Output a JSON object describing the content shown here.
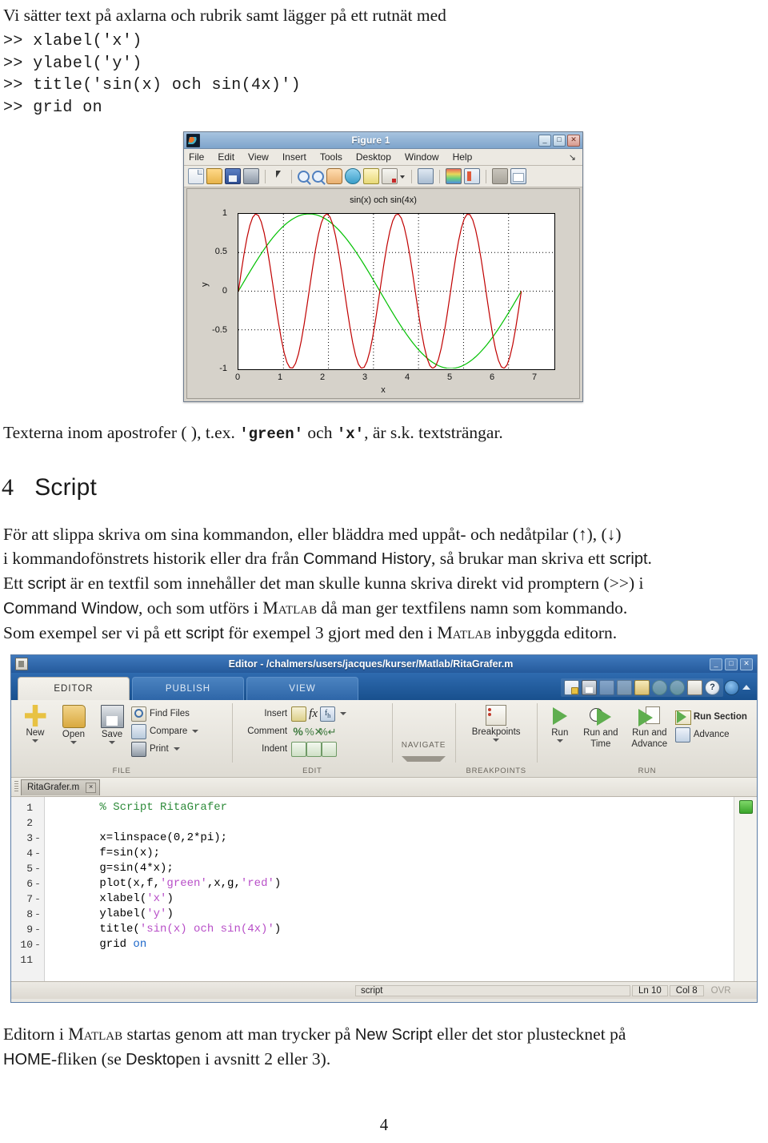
{
  "document": {
    "intro_sentence": "Vi sätter text på axlarna och rubrik samt lägger på ett rutnät med",
    "commands": [
      ">> xlabel('x')",
      ">> ylabel('y')",
      ">> title('sin(x) och sin(4x)')",
      ">> grid on"
    ],
    "texterna_line": {
      "part1": "Texterna inom apostrofer (  ), t.ex. ",
      "green": "'green'",
      "mid": " och ",
      "x": "'x'",
      "part2": ", är s.k. textsträngar."
    },
    "section": {
      "number": "4",
      "title": "Script"
    },
    "paragraph1": {
      "l1a": "För att slippa skriva om sina kommandon, eller bläddra med uppåt- och nedåtpilar (↑), (↓)",
      "l2a": "i kommandofönstrets historik eller dra från ",
      "l2b": "Command History",
      "l2c": ", så brukar man skriva ett ",
      "l2d": "script",
      "l2e": ".",
      "l3a": "Ett ",
      "l3b": "script",
      "l3c": " är en textfil som innehåller det man skulle kunna skriva direkt vid promptern (>>) i",
      "l4a": "Command Window",
      "l4b": ", och som utförs i ",
      "l4c": "Matlab",
      "l4d": " då man ger textfilens namn som kommando."
    },
    "paragraph2": {
      "a": "Som exempel ser vi på ett ",
      "b": "script",
      "c": " för exempel 3 gjort med den i ",
      "d": "Matlab",
      "e": " inbyggda editorn."
    },
    "paragraph3": {
      "a": "Editorn i ",
      "b": "Matlab",
      "c": " startas genom att man trycker på ",
      "d": "New Script",
      "e": " eller det stor plustecknet på",
      "f": "HOME",
      "g": "-fliken (se ",
      "h": "Desktop",
      "i": "en i avsnitt 2 eller 3)."
    },
    "page_number": "4"
  },
  "figure_window": {
    "title": "Figure 1",
    "window_buttons": {
      "minimize": "_",
      "maximize": "□",
      "close": "✕"
    },
    "menu": [
      "File",
      "Edit",
      "View",
      "Insert",
      "Tools",
      "Desktop",
      "Window",
      "Help"
    ],
    "dock_icon": "↘",
    "toolbar_icons": [
      "new-figure-icon",
      "open-file-icon",
      "save-figure-icon",
      "print-figure-icon",
      "pointer-icon",
      "zoom-in-icon",
      "zoom-out-icon",
      "pan-icon",
      "rotate-3d-icon",
      "data-cursor-icon",
      "brush-icon",
      "brush-dropdown-icon",
      "link-plot-icon",
      "colorbar-icon",
      "legend-icon",
      "plot-tools-off-icon",
      "plot-tools-on-icon"
    ]
  },
  "chart_data": {
    "type": "line",
    "title": "sin(x) och sin(4x)",
    "xlabel": "x",
    "ylabel": "y",
    "xlim": [
      0,
      7
    ],
    "ylim": [
      -1,
      1
    ],
    "xticks": [
      0,
      1,
      2,
      3,
      4,
      5,
      6,
      7
    ],
    "yticks": [
      -1,
      -0.5,
      0,
      0.5,
      1
    ],
    "grid": true,
    "grid_style": "dotted",
    "data_range_x": [
      0,
      6.2832
    ],
    "series": [
      {
        "name": "sin(x)",
        "color": "#00c000",
        "expression": "sin(x)",
        "points": 100
      },
      {
        "name": "sin(4x)",
        "color": "#c00000",
        "expression": "sin(4*x)",
        "points": 100
      }
    ]
  },
  "editor_window": {
    "title": "Editor - /chalmers/users/jacques/kurser/Matlab/RitaGrafer.m",
    "window_buttons": {
      "minimize": "_",
      "maximize": "□",
      "close": "✕"
    },
    "ribbon_tabs": [
      "EDITOR",
      "PUBLISH",
      "VIEW"
    ],
    "active_tab": "EDITOR",
    "quick_access_icons": [
      "new-script-icon",
      "save-icon",
      "cut-icon",
      "copy-icon",
      "paste-icon",
      "undo-icon",
      "redo-icon",
      "layout-icon",
      "help-icon",
      "quick-access-dropdown-icon",
      "minimize-ribbon-icon"
    ],
    "groups": [
      {
        "label": "FILE",
        "big_buttons": [
          {
            "label": "New",
            "icon": "new-file-icon",
            "has_arrow": true
          },
          {
            "label": "Open",
            "icon": "open-file-icon",
            "has_arrow": true
          },
          {
            "label": "Save",
            "icon": "save-file-icon",
            "has_arrow": true
          }
        ],
        "small_buttons": [
          {
            "label": "Find Files",
            "icon": "find-files-icon",
            "has_arrow": false
          },
          {
            "label": "Compare",
            "icon": "compare-icon",
            "has_arrow": true
          },
          {
            "label": "Print",
            "icon": "print-icon",
            "has_arrow": true
          }
        ]
      },
      {
        "label": "EDIT",
        "rows": [
          {
            "label": "Insert",
            "icons": [
              "insert-snippet-icon",
              "insert-function-icon",
              "insert-fh-icon"
            ],
            "has_arrow": true
          },
          {
            "label": "Comment",
            "icons": [
              "comment-icon",
              "uncomment-icon",
              "wrap-comment-icon"
            ],
            "has_arrow": false
          },
          {
            "label": "Indent",
            "icons": [
              "smart-indent-icon",
              "indent-right-icon",
              "indent-left-icon"
            ],
            "has_arrow": false
          }
        ]
      },
      {
        "label": "",
        "navigate_label": "NAVIGATE"
      },
      {
        "label": "BREAKPOINTS",
        "big_buttons": [
          {
            "label": "Breakpoints",
            "icon": "breakpoints-icon",
            "has_arrow": true
          }
        ]
      },
      {
        "label": "RUN",
        "big_buttons": [
          {
            "label": "Run",
            "icon": "run-icon",
            "has_arrow": true
          },
          {
            "label": "Run and\nTime",
            "icon": "run-and-time-icon",
            "has_arrow": false
          },
          {
            "label": "Run and\nAdvance",
            "icon": "run-and-advance-icon",
            "has_arrow": false
          }
        ],
        "small_buttons": [
          {
            "label": "Run Section",
            "icon": "run-section-icon"
          },
          {
            "label": "Advance",
            "icon": "advance-icon"
          }
        ]
      }
    ],
    "group_labels": {
      "file": "FILE",
      "edit": "EDIT",
      "navigate": "NAVIGATE",
      "breakpoints": "BREAKPOINTS",
      "run": "RUN"
    },
    "button_labels": {
      "new": "New",
      "open": "Open",
      "save": "Save",
      "find_files": "Find Files",
      "compare": "Compare",
      "print": "Print",
      "insert": "Insert",
      "comment": "Comment",
      "indent": "Indent",
      "breakpoints": "Breakpoints",
      "run": "Run",
      "run_and_time_1": "Run and",
      "run_and_time_2": "Time",
      "run_and_advance_1": "Run and",
      "run_and_advance_2": "Advance",
      "run_section": "Run Section",
      "advance": "Advance"
    },
    "file_tab": {
      "name": "RitaGrafer.m",
      "close": "×"
    },
    "code_lines": [
      {
        "num": "1",
        "dash": "",
        "segments": [
          {
            "t": "      % Script RitaGrafer",
            "c": "c-comment"
          }
        ]
      },
      {
        "num": "2",
        "dash": "",
        "segments": [
          {
            "t": "",
            "c": ""
          }
        ]
      },
      {
        "num": "3",
        "dash": "-",
        "segments": [
          {
            "t": "      x=linspace(0,2*pi);",
            "c": ""
          }
        ]
      },
      {
        "num": "4",
        "dash": "-",
        "segments": [
          {
            "t": "      f=sin(x);",
            "c": ""
          }
        ]
      },
      {
        "num": "5",
        "dash": "-",
        "segments": [
          {
            "t": "      g=sin(4*x);",
            "c": ""
          }
        ]
      },
      {
        "num": "6",
        "dash": "-",
        "segments": [
          {
            "t": "      plot(x,f,",
            "c": ""
          },
          {
            "t": "'green'",
            "c": "c-string"
          },
          {
            "t": ",x,g,",
            "c": ""
          },
          {
            "t": "'red'",
            "c": "c-string"
          },
          {
            "t": ")",
            "c": ""
          }
        ]
      },
      {
        "num": "7",
        "dash": "-",
        "segments": [
          {
            "t": "      xlabel(",
            "c": ""
          },
          {
            "t": "'x'",
            "c": "c-string"
          },
          {
            "t": ")",
            "c": ""
          }
        ]
      },
      {
        "num": "8",
        "dash": "-",
        "segments": [
          {
            "t": "      ylabel(",
            "c": ""
          },
          {
            "t": "'y'",
            "c": "c-string"
          },
          {
            "t": ")",
            "c": ""
          }
        ]
      },
      {
        "num": "9",
        "dash": "-",
        "segments": [
          {
            "t": "      title(",
            "c": ""
          },
          {
            "t": "'sin(x) och sin(4x)'",
            "c": "c-string"
          },
          {
            "t": ")",
            "c": ""
          }
        ]
      },
      {
        "num": "10",
        "dash": "-",
        "segments": [
          {
            "t": "      grid ",
            "c": ""
          },
          {
            "t": "on",
            "c": "c-kw"
          }
        ]
      },
      {
        "num": "11",
        "dash": "",
        "segments": [
          {
            "t": "",
            "c": ""
          }
        ]
      }
    ],
    "status_bar": {
      "file_type": "script",
      "line": "Ln  10",
      "column": "Col  8",
      "overwrite": "OVR"
    },
    "code_analyzer_status": "ok-green"
  },
  "colors": {
    "sin_x_green": "#00c000",
    "sin_4x_red": "#c00000",
    "title_bar_blue": "#2f6bb0",
    "figure_title_blue": "#7ea4cc",
    "analyzer_green": "#3aa42a"
  }
}
